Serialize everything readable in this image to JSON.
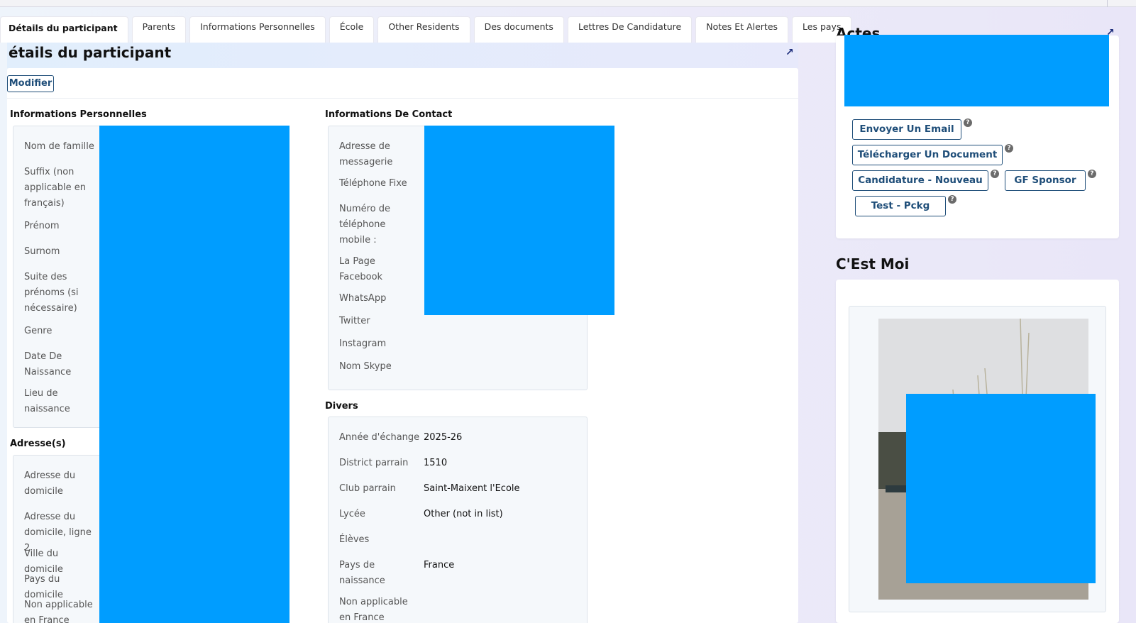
{
  "tabs": [
    {
      "label": "Détails du participant",
      "active": true
    },
    {
      "label": "Parents"
    },
    {
      "label": "Informations Personnelles"
    },
    {
      "label": "École"
    },
    {
      "label": "Other Residents"
    },
    {
      "label": "Des documents"
    },
    {
      "label": "Lettres De Candidature"
    },
    {
      "label": "Notes Et Alertes"
    },
    {
      "label": "Les pays"
    }
  ],
  "page": {
    "title": "étails du participant",
    "edit_label": "Modifier"
  },
  "personal": {
    "title": "Informations Personnelles",
    "labels": [
      "Nom de famille",
      "Suffix (non applicable en français)",
      "Prénom",
      "Surnom",
      "Suite des prénoms (si nécessaire)",
      "Genre",
      "Date De Naissance",
      "Lieu de naissance"
    ]
  },
  "addresses": {
    "title": "Adresse(s)",
    "labels": [
      "Adresse du domicile",
      "Adresse du domicile, ligne 2",
      "Ville du domicile",
      "Pays du domicile",
      "Non applicable en France"
    ]
  },
  "contact": {
    "title": "Informations De Contact",
    "labels": [
      "Adresse de messagerie",
      "Téléphone Fixe",
      "Numéro de téléphone mobile :",
      "La Page Facebook",
      "WhatsApp",
      "Twitter",
      "Instagram",
      "Nom Skype"
    ]
  },
  "misc": {
    "title": "Divers",
    "rows": [
      {
        "label": "Année d'échange",
        "value": "2025-26"
      },
      {
        "label": "District parrain",
        "value": "1510"
      },
      {
        "label": "Club parrain",
        "value": "Saint-Maixent l'Ecole"
      },
      {
        "label": "Lycée",
        "value": "Other (not in list)"
      },
      {
        "label": "Élèves",
        "value": ""
      },
      {
        "label": "Pays de naissance",
        "value": "France"
      },
      {
        "label": "Non applicable en France",
        "value": ""
      }
    ]
  },
  "actions": {
    "title": "Actes",
    "buttons": [
      "Envoyer Un Email",
      "Télécharger Un Document",
      "Candidature - Nouveau",
      "GF Sponsor",
      "Test - Pckg"
    ],
    "help_glyph": "?"
  },
  "about": {
    "title": "C'Est Moi"
  },
  "icons": {
    "expand": "↗"
  },
  "colors": {
    "accent": "#1f4e79",
    "redaction": "#009dff"
  }
}
